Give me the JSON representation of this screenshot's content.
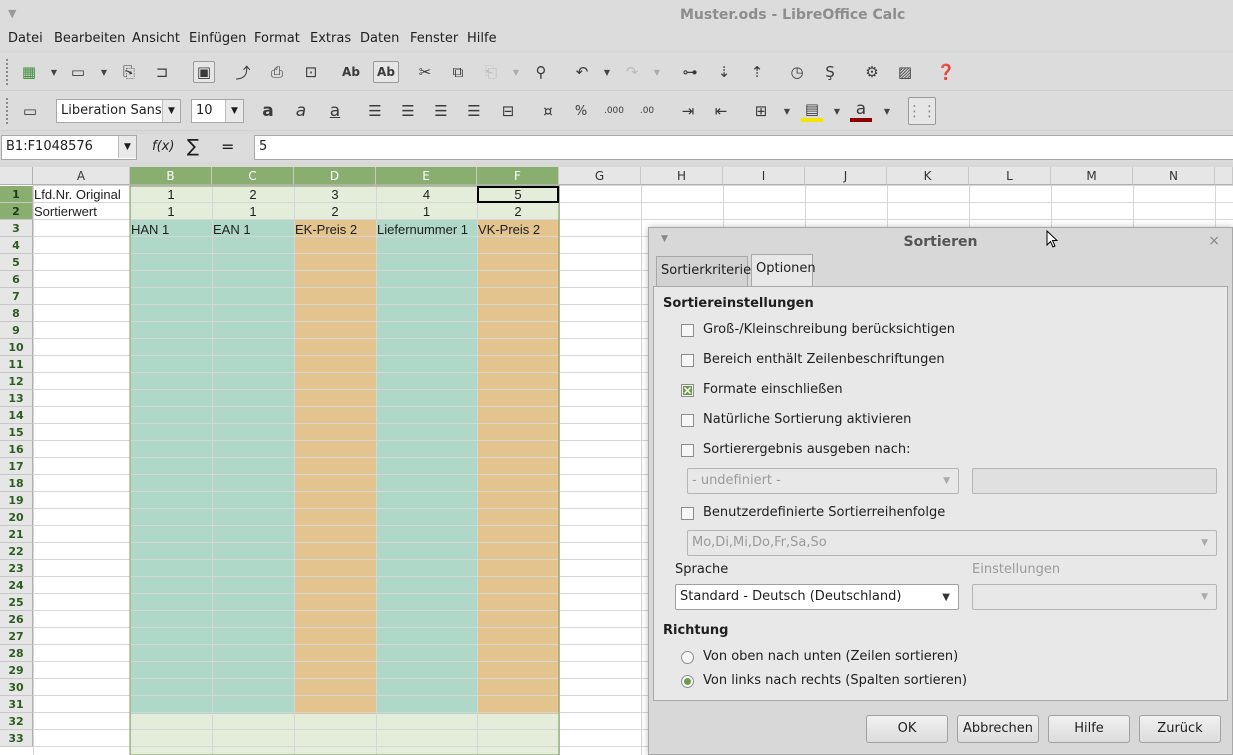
{
  "window": {
    "title": "Muster.ods - LibreOffice Calc"
  },
  "menu": [
    "Datei",
    "Bearbeiten",
    "Ansicht",
    "Einfügen",
    "Format",
    "Extras",
    "Daten",
    "Fenster",
    "Hilfe"
  ],
  "toolbar2": {
    "font_name": "Liberation Sans",
    "font_size": "10"
  },
  "formula_bar": {
    "name_box": "B1:F1048576",
    "fx": "f(x)",
    "sum": "∑",
    "equals": "=",
    "content": "5"
  },
  "sheet": {
    "columns": [
      "A",
      "B",
      "C",
      "D",
      "E",
      "F",
      "G",
      "H",
      "I",
      "J",
      "K",
      "L",
      "M",
      "N"
    ],
    "rows": [
      "1",
      "2",
      "3",
      "4",
      "5",
      "6",
      "7",
      "8",
      "9",
      "10",
      "11",
      "12",
      "13",
      "14",
      "15",
      "16",
      "17",
      "18",
      "19",
      "20",
      "21",
      "22",
      "23",
      "24",
      "25",
      "26",
      "27",
      "28",
      "29",
      "30",
      "31",
      "32",
      "33"
    ],
    "row1": {
      "A": "Lfd.Nr. Original",
      "B": "1",
      "C": "2",
      "D": "3",
      "E": "4",
      "F": "5"
    },
    "row2": {
      "A": "Sortierwert",
      "B": "1",
      "C": "1",
      "D": "2",
      "E": "1",
      "F": "2"
    },
    "row3": {
      "B": "HAN 1",
      "C": "EAN 1",
      "D": "EK-Preis 2",
      "E": "Liefernummer 1",
      "F": "VK-Preis 2"
    },
    "colors": {
      "teal": "#b0d8c9",
      "orange": "#e3c48e",
      "sel_header": "#8aae70",
      "sel_light": "#e4edd9"
    }
  },
  "dialog": {
    "title": "Sortieren",
    "tabs": [
      "Sortierkriterien",
      "Optionen"
    ],
    "section_settings": "Sortiereinstellungen",
    "options": [
      {
        "label": "Groß-/Kleinschreibung berücksichtigen",
        "checked": false
      },
      {
        "label": "Bereich enthält Zeilenbeschriftungen",
        "checked": false
      },
      {
        "label": "Formate einschließen",
        "checked": true
      },
      {
        "label": "Natürliche Sortierung aktivieren",
        "checked": false
      },
      {
        "label": "Sortierergebnis ausgeben nach:",
        "checked": false
      }
    ],
    "output_select": "- undefiniert -",
    "custom_order_label": "Benutzerdefinierte Sortierreihenfolge",
    "custom_order_select": "Mo,Di,Mi,Do,Fr,Sa,So",
    "language_label": "Sprache",
    "language_select": "Standard - Deutsch (Deutschland)",
    "settings_label": "Einstellungen",
    "direction_label": "Richtung",
    "direction_options": [
      {
        "label": "Von oben nach unten (Zeilen sortieren)",
        "selected": false
      },
      {
        "label": "Von links nach rechts (Spalten sortieren)",
        "selected": true
      }
    ],
    "buttons": {
      "ok": "OK",
      "cancel": "Abbrechen",
      "help": "Hilfe",
      "reset": "Zurück"
    }
  }
}
